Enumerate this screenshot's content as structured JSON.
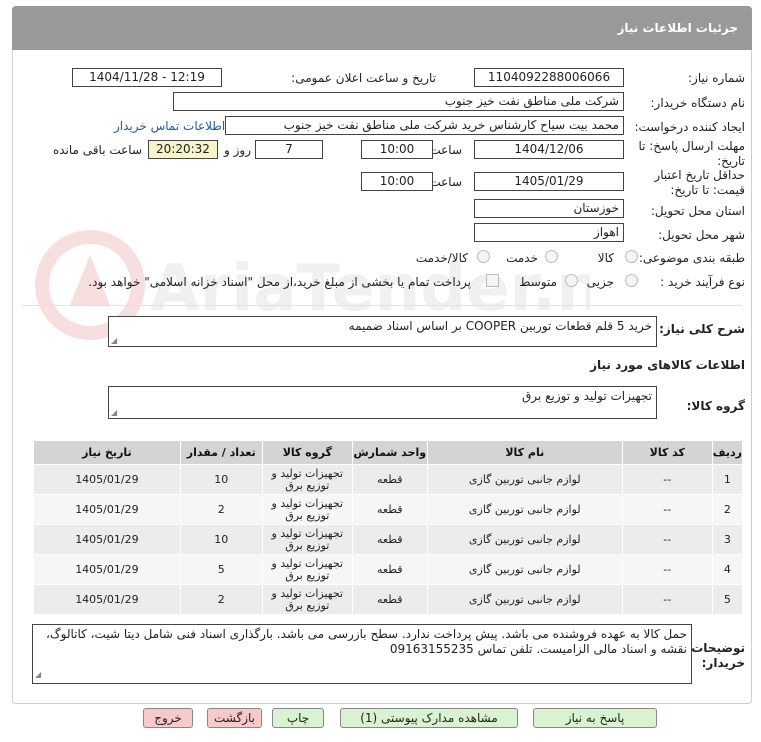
{
  "header": {
    "title": "جزئیات اطلاعات نیاز"
  },
  "form": {
    "need_number_label": "شماره نیاز:",
    "need_number": "1104092288006066",
    "announce_label": "تاریخ و ساعت اعلان عمومی:",
    "announce_value": "1404/11/28 - 12:19",
    "buyer_org_label": "نام دستگاه خریدار:",
    "buyer_org": "شرکت ملی مناطق نفت خیز جنوب",
    "creator_label": "ایجاد کننده درخواست:",
    "creator": "محمد بیت سیاح کارشناس خرید شرکت ملی مناطق نفت خیز جنوب",
    "contact_link": "اطلاعات تماس خریدار",
    "deadline_label_1": "مهلت ارسال پاسخ: تا",
    "deadline_label_2": "تاریخ:",
    "deadline_date": "1404/12/06",
    "time_label": "ساعت",
    "deadline_time": "10:00",
    "days_value": "7",
    "days_label": "روز و",
    "remaining_value": "20:20:32",
    "remaining_label": "ساعت باقی مانده",
    "validity_label_1": "حداقل تاریخ اعتبار",
    "validity_label_2": "قیمت: تا تاریخ:",
    "validity_date": "1405/01/29",
    "validity_time": "10:00",
    "province_label": "استان محل تحویل:",
    "province": "خوزستان",
    "city_label": "شهر محل تحویل:",
    "city": "اهواز",
    "category_label": "طبقه بندی موضوعی:",
    "category_options": [
      "کالا",
      "خدمت",
      "کالا/خدمت"
    ],
    "process_label": "نوع فرآیند خرید :",
    "process_options": [
      "جزیی",
      "متوسط"
    ],
    "payment_note": "پرداخت تمام یا بخشی از مبلغ خرید،از محل \"اسناد خزانه اسلامی\" خواهد بود."
  },
  "summary": {
    "label": "شرح کلی نیاز:",
    "value": "خرید 5 قلم قطعات توربین COOPER بر اساس اسناد ضمیمه"
  },
  "goods_info_label": "اطلاعات کالاهای مورد نیاز",
  "goods_group": {
    "label": "گروه کالا:",
    "value": "تجهیزات تولید و توزیع برق"
  },
  "table": {
    "headers": [
      "ردیف",
      "کد کالا",
      "نام کالا",
      "واحد شمارش",
      "گروه کالا",
      "تعداد / مقدار",
      "تاریخ نیاز"
    ],
    "rows": [
      [
        "1",
        "--",
        "لوازم جانبی توربین گازی",
        "قطعه",
        "تجهیزات تولید و توزیع برق",
        "10",
        "1405/01/29"
      ],
      [
        "2",
        "--",
        "لوازم جانبی توربین گازی",
        "قطعه",
        "تجهیزات تولید و توزیع برق",
        "2",
        "1405/01/29"
      ],
      [
        "3",
        "--",
        "لوازم جانبی توربین گازی",
        "قطعه",
        "تجهیزات تولید و توزیع برق",
        "10",
        "1405/01/29"
      ],
      [
        "4",
        "--",
        "لوازم جانبی توربین گازی",
        "قطعه",
        "تجهیزات تولید و توزیع برق",
        "5",
        "1405/01/29"
      ],
      [
        "5",
        "--",
        "لوازم جانبی توربین گازی",
        "قطعه",
        "تجهیزات تولید و توزیع برق",
        "2",
        "1405/01/29"
      ]
    ]
  },
  "buyer_notes": {
    "label_1": "توضیحات",
    "label_2": "خریدار:",
    "value": "حمل کالا به عهده فروشنده می باشد. پیش پرداخت ندارد. سطح بازرسی  می باشد. بارگذاری اسناد فنی شامل دیتا شیت، کاتالوگ، نقشه و اسناد مالی الزامیست. تلفن تماس 09163155235"
  },
  "buttons": {
    "reply": "پاسخ به نیاز",
    "view_docs": "مشاهده مدارک پیوستی (1)",
    "print": "چاپ",
    "back": "بازگشت",
    "exit": "خروج"
  },
  "watermark_text": "AriaTender.neT",
  "colors": {
    "header_bg": "#999999",
    "button_green": "#d9f3d1",
    "button_red": "#f7c9c9",
    "link": "#1a5ab4",
    "highlight": "#f7f4c8"
  }
}
